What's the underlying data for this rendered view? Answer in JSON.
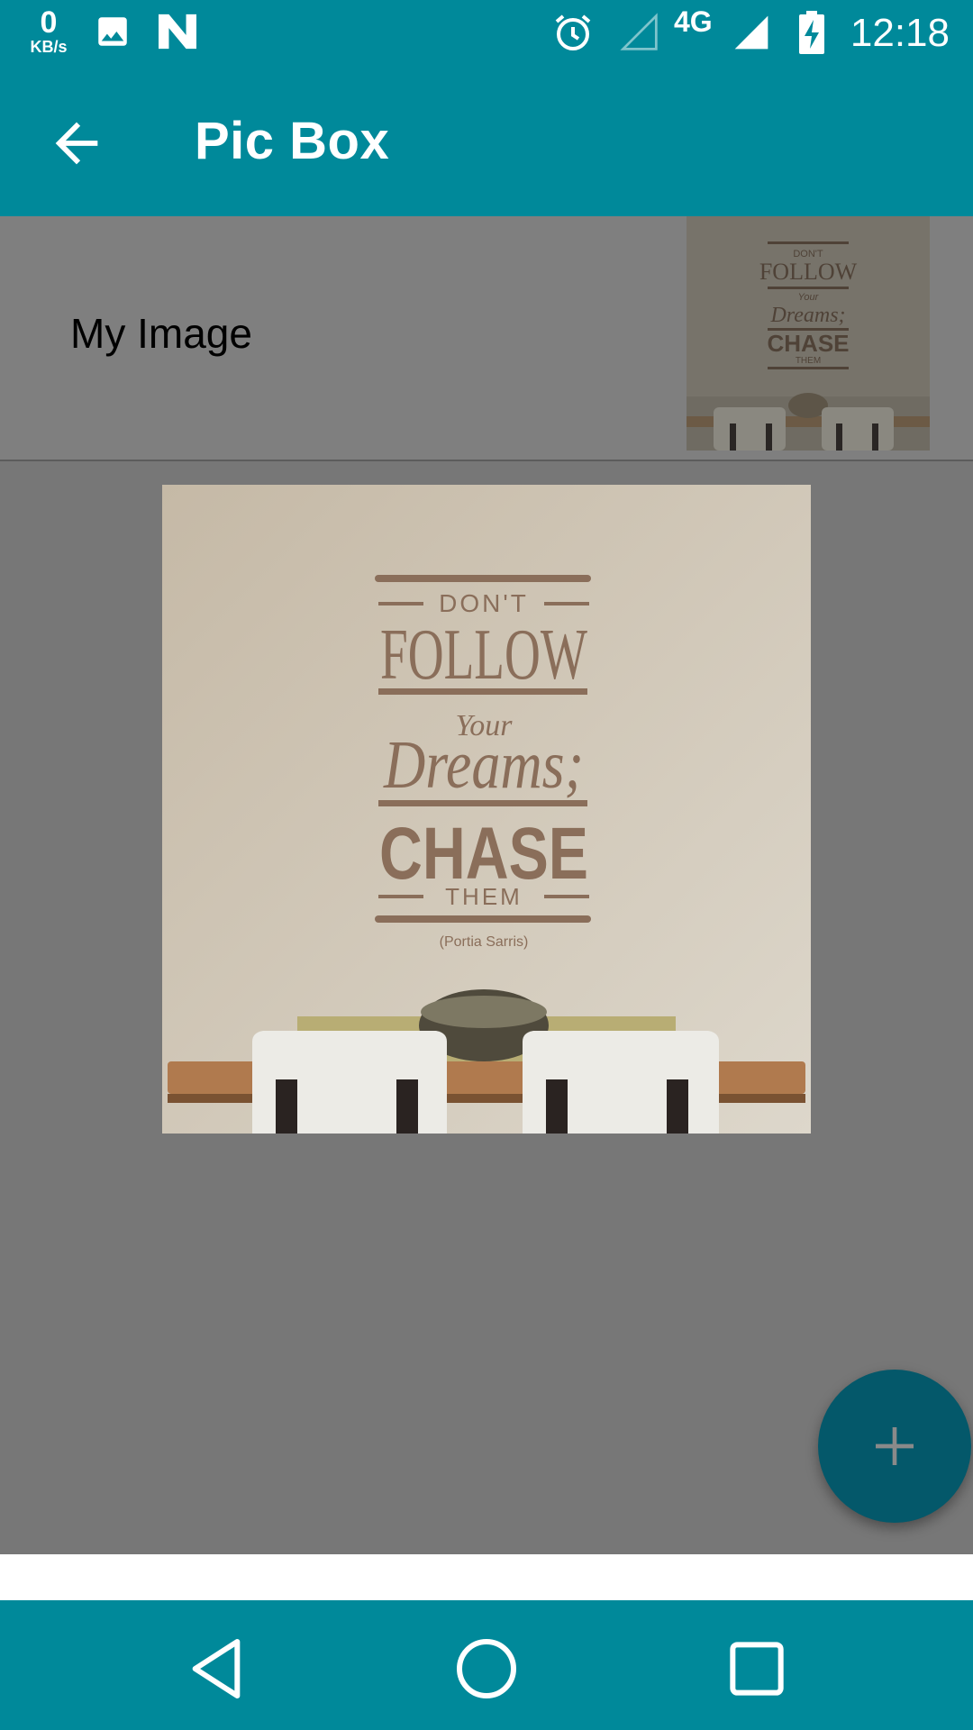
{
  "status_bar": {
    "speed_value": "0",
    "speed_unit": "KB/s",
    "network_label": "4G",
    "time": "12:18",
    "icons": [
      "image-icon",
      "n-logo-icon",
      "alarm-icon",
      "signal-empty-icon",
      "signal-full-icon",
      "battery-charging-icon"
    ]
  },
  "app_bar": {
    "title": "Pic Box",
    "back_icon": "arrow-back-icon"
  },
  "list": {
    "items": [
      {
        "label": "My Image"
      }
    ]
  },
  "preview": {
    "poster_text": {
      "line1": "DON'T",
      "line2": "FOLLOW",
      "line3": "Your",
      "line4": "Dreams;",
      "line5": "CHASE",
      "line6": "THEM",
      "attribution": "(Portia Sarris)"
    }
  },
  "fab": {
    "icon": "plus-icon"
  },
  "nav_bar": {
    "icons": [
      "back-triangle-icon",
      "home-circle-icon",
      "recents-square-icon"
    ]
  },
  "colors": {
    "primary": "#00899a",
    "fab": "#04586a",
    "scrim": "#777777",
    "poster_text": "#8a6e5a"
  }
}
